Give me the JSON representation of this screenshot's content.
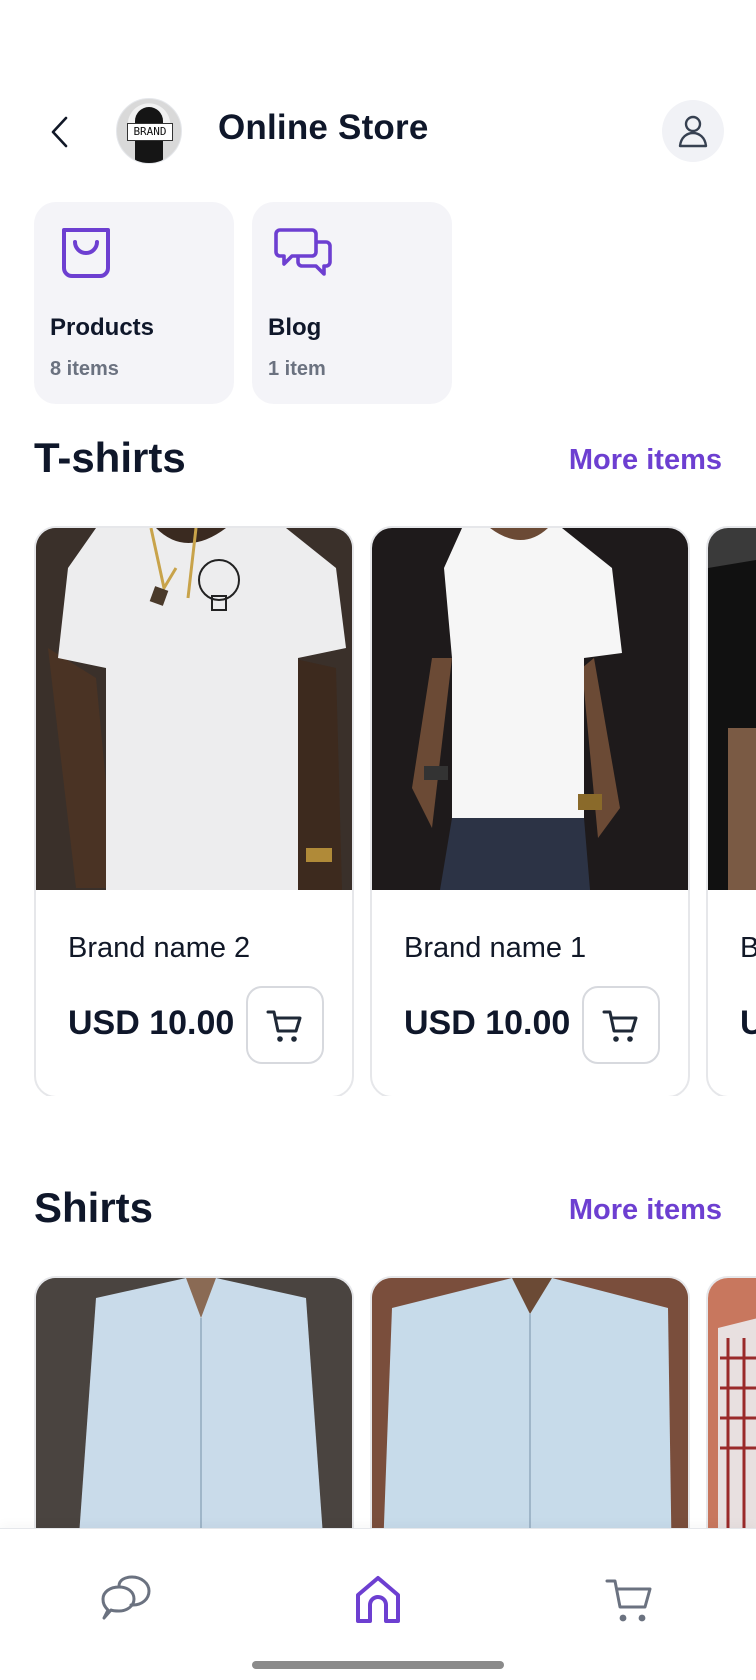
{
  "header": {
    "title": "Online Store",
    "brand_avatar_text": "BRAND"
  },
  "tiles": [
    {
      "name": "Products",
      "count": "8 items",
      "icon": "shopping-bag-icon"
    },
    {
      "name": "Blog",
      "count": "1 item",
      "icon": "chat-bubbles-icon"
    }
  ],
  "sections": [
    {
      "title": "T-shirts",
      "more_label": "More items",
      "products": [
        {
          "brand": "Brand name 2",
          "price": "USD 10.00",
          "image": "white t-shirt with necklace and bulb print"
        },
        {
          "brand": "Brand name 1",
          "price": "USD 10.00",
          "image": "plain white t-shirt, dark background"
        },
        {
          "brand": "B",
          "price": "U",
          "image": "black t-shirt (cut off)"
        }
      ]
    },
    {
      "title": "Shirts",
      "more_label": "More items",
      "products": [
        {
          "image": "light blue shirt, stone wall"
        },
        {
          "image": "light blue shirt, brick wall"
        },
        {
          "image": "plaid shirt (cut off)"
        }
      ]
    }
  ],
  "bottom_nav": {
    "items": [
      {
        "icon": "chat-icon",
        "active": false
      },
      {
        "icon": "home-icon",
        "active": true
      },
      {
        "icon": "cart-icon",
        "active": false
      }
    ]
  },
  "colors": {
    "accent": "#6d3fd1",
    "tile_bg": "#f4f4f8",
    "text": "#0f172a",
    "muted": "#6b7280"
  }
}
